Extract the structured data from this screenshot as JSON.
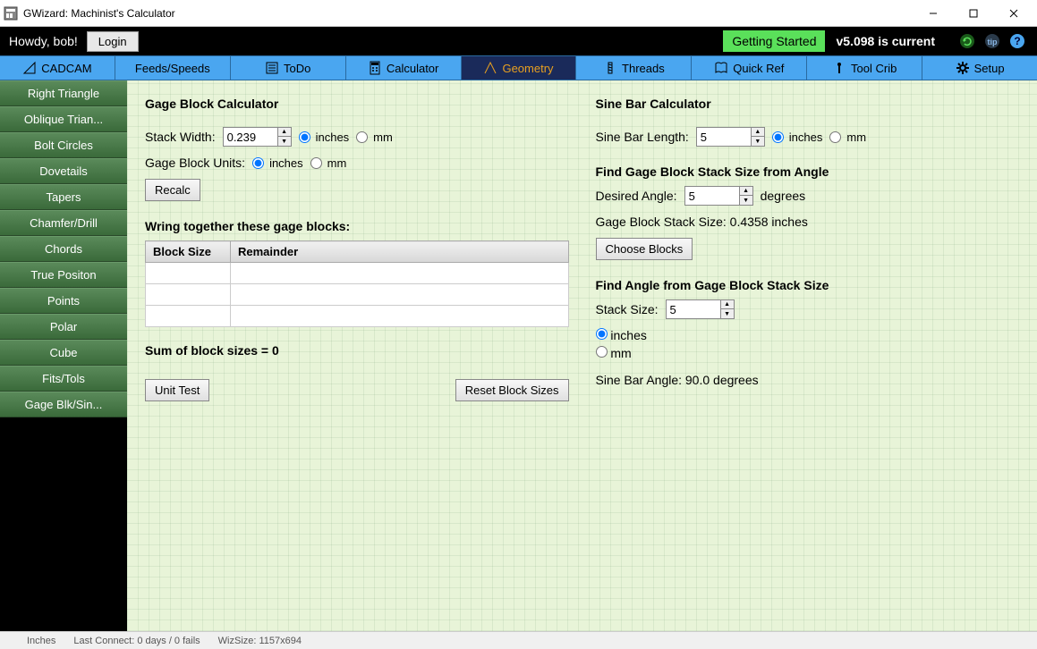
{
  "window": {
    "title": "GWizard: Machinist's Calculator"
  },
  "topbar": {
    "greeting": "Howdy, bob!",
    "login": "Login",
    "getting_started": "Getting Started",
    "version": "v5.098 is current"
  },
  "nav": {
    "items": [
      {
        "label": "CADCAM"
      },
      {
        "label": "Feeds/Speeds"
      },
      {
        "label": "ToDo"
      },
      {
        "label": "Calculator"
      },
      {
        "label": "Geometry"
      },
      {
        "label": "Threads"
      },
      {
        "label": "Quick Ref"
      },
      {
        "label": "Tool Crib"
      },
      {
        "label": "Setup"
      }
    ]
  },
  "sidebar": {
    "items": [
      {
        "label": "Right Triangle"
      },
      {
        "label": "Oblique Trian..."
      },
      {
        "label": "Bolt Circles"
      },
      {
        "label": "Dovetails"
      },
      {
        "label": "Tapers"
      },
      {
        "label": "Chamfer/Drill"
      },
      {
        "label": "Chords"
      },
      {
        "label": "True Positon"
      },
      {
        "label": "Points"
      },
      {
        "label": "Polar"
      },
      {
        "label": "Cube"
      },
      {
        "label": "Fits/Tols"
      },
      {
        "label": "Gage Blk/Sin..."
      }
    ]
  },
  "left": {
    "title": "Gage Block Calculator",
    "stack_width_label": "Stack Width:",
    "stack_width_value": "0.239",
    "unit_inches": "inches",
    "unit_mm": "mm",
    "gage_block_units_label": "Gage Block Units:",
    "recalc": "Recalc",
    "wring_heading": "Wring together these gage blocks:",
    "col_block": "Block Size",
    "col_remain": "Remainder",
    "sum": "Sum of block sizes = 0",
    "unit_test": "Unit Test",
    "reset": "Reset Block Sizes"
  },
  "right": {
    "title": "Sine Bar Calculator",
    "sine_len_label": "Sine Bar Length:",
    "sine_len_value": "5",
    "unit_inches": "inches",
    "unit_mm": "mm",
    "find_stack_heading": "Find Gage Block Stack Size from Angle",
    "desired_angle_label": "Desired Angle:",
    "desired_angle_value": "5",
    "degrees": "degrees",
    "stack_result": "Gage Block Stack Size: 0.4358 inches",
    "choose_blocks": "Choose Blocks",
    "find_angle_heading": "Find Angle from Gage Block Stack Size",
    "stack_size_label": "Stack Size:",
    "stack_size_value": "5",
    "angle_result": "Sine Bar Angle: 90.0 degrees"
  },
  "status": {
    "s1": "Inches",
    "s2": "Last Connect: 0 days / 0 fails",
    "s3": "WizSize: 1157x694"
  }
}
